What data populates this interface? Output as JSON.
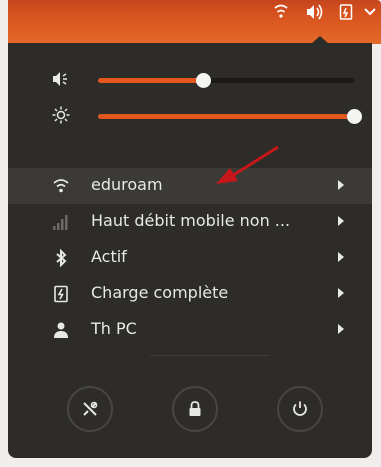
{
  "menu": {
    "network": {
      "label": "eduroam"
    },
    "mobile": {
      "label": "Haut débit mobile non ..."
    },
    "bluetooth": {
      "label": "Actif"
    },
    "battery": {
      "label": "Charge complète"
    },
    "user": {
      "label": "Th PC"
    }
  },
  "sliders": {
    "volume": {
      "level": 0.41
    },
    "brightness": {
      "level": 1.0
    }
  },
  "icons": {
    "tray": [
      "wifi-icon",
      "volume-icon",
      "battery-icon",
      "chevron-down-icon"
    ],
    "actions": [
      "settings-icon",
      "lock-icon",
      "power-icon"
    ]
  },
  "colors": {
    "panel": "#2d2c29",
    "accent": "#e4571f",
    "topbar": "#d8531f"
  }
}
